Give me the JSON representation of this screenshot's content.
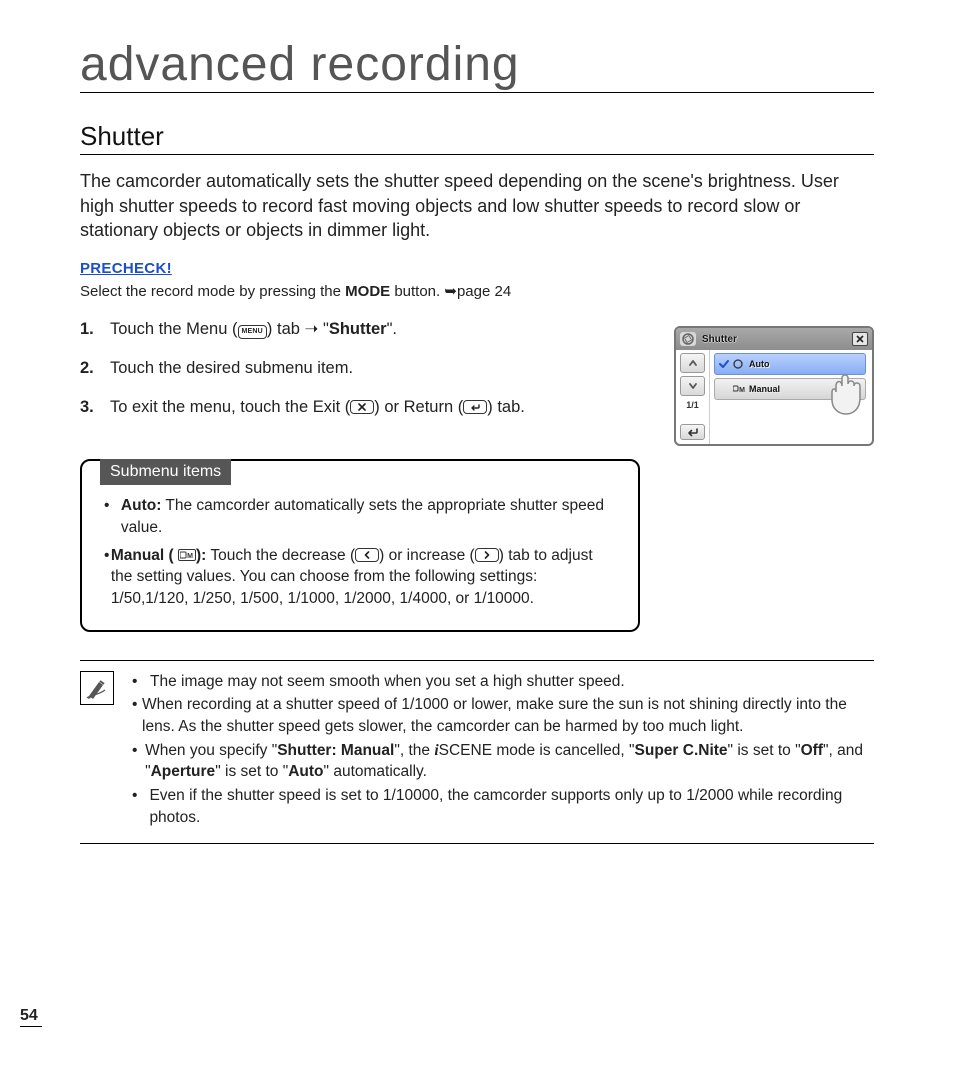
{
  "chapter_title": "advanced recording",
  "section_title": "Shutter",
  "intro_text": "The camcorder automatically sets the shutter speed depending on the scene's brightness. User high shutter speeds to record fast moving objects and low shutter speeds to record slow or stationary objects or objects in dimmer light.",
  "precheck": {
    "label": "PRECHECK!",
    "pre": "Select the record mode by pressing the ",
    "mode_word": "MODE",
    "post": " button. ",
    "arrow": "➥",
    "page_ref": "page 24"
  },
  "steps": [
    {
      "num": "1.",
      "pre": "Touch the Menu (",
      "btn1": "MENU",
      "mid1": ") tab ",
      "arrow": "➝",
      "mid2": " \"",
      "target": "Shutter",
      "post": "\"."
    },
    {
      "num": "2.",
      "text": "Touch the desired submenu item."
    },
    {
      "num": "3.",
      "pre": "To exit the menu, touch the Exit (",
      "btn_exit_glyph": "✕",
      "mid": ") or Return (",
      "btn_return_glyph": "↩",
      "post": ") tab."
    }
  ],
  "submenu": {
    "tab_label": "Submenu items",
    "auto_label": "Auto:",
    "auto_desc": " The camcorder automatically sets the appropriate shutter speed value.",
    "manual_label": "Manual (",
    "manual_icon_glyph": "M",
    "manual_label_close": "):",
    "manual_pre": " Touch the decrease (",
    "dec_glyph": "‹",
    "manual_mid": ") or increase (",
    "inc_glyph": "›",
    "manual_post": ") tab to adjust the setting values. You can choose from the following settings: 1/50,1/120, 1/250, 1/500, 1/1000, 1/2000, 1/4000, or 1/10000."
  },
  "notes": {
    "n1": "The image may not seem smooth when you set a high shutter speed.",
    "n2": "When recording at a shutter speed of 1/1000 or lower, make sure the sun is not shining directly into the lens. As the shutter speed gets slower, the camcorder can be harmed by too much light.",
    "n3_pre": "When you specify \"",
    "n3_b1": "Shutter: Manual",
    "n3_mid1": "\", the ",
    "n3_iglyph": "i",
    "n3_mid1b": "SCENE mode is cancelled, \"",
    "n3_b2": "Super C.Nite",
    "n3_mid2": "\" is set to \"",
    "n3_b3": "Off",
    "n3_mid3": "\", and \"",
    "n3_b4": "Aperture",
    "n3_mid4": "\" is set to \"",
    "n3_b5": "Auto",
    "n3_post": "\" automatically.",
    "n4": "Even if the shutter speed is set to 1/10000, the camcorder supports only up to 1/2000 while recording photos."
  },
  "device": {
    "header_title": "Shutter",
    "page_indicator": "1/1",
    "option_auto": "Auto",
    "option_manual": "Manual"
  },
  "page_number": "54"
}
